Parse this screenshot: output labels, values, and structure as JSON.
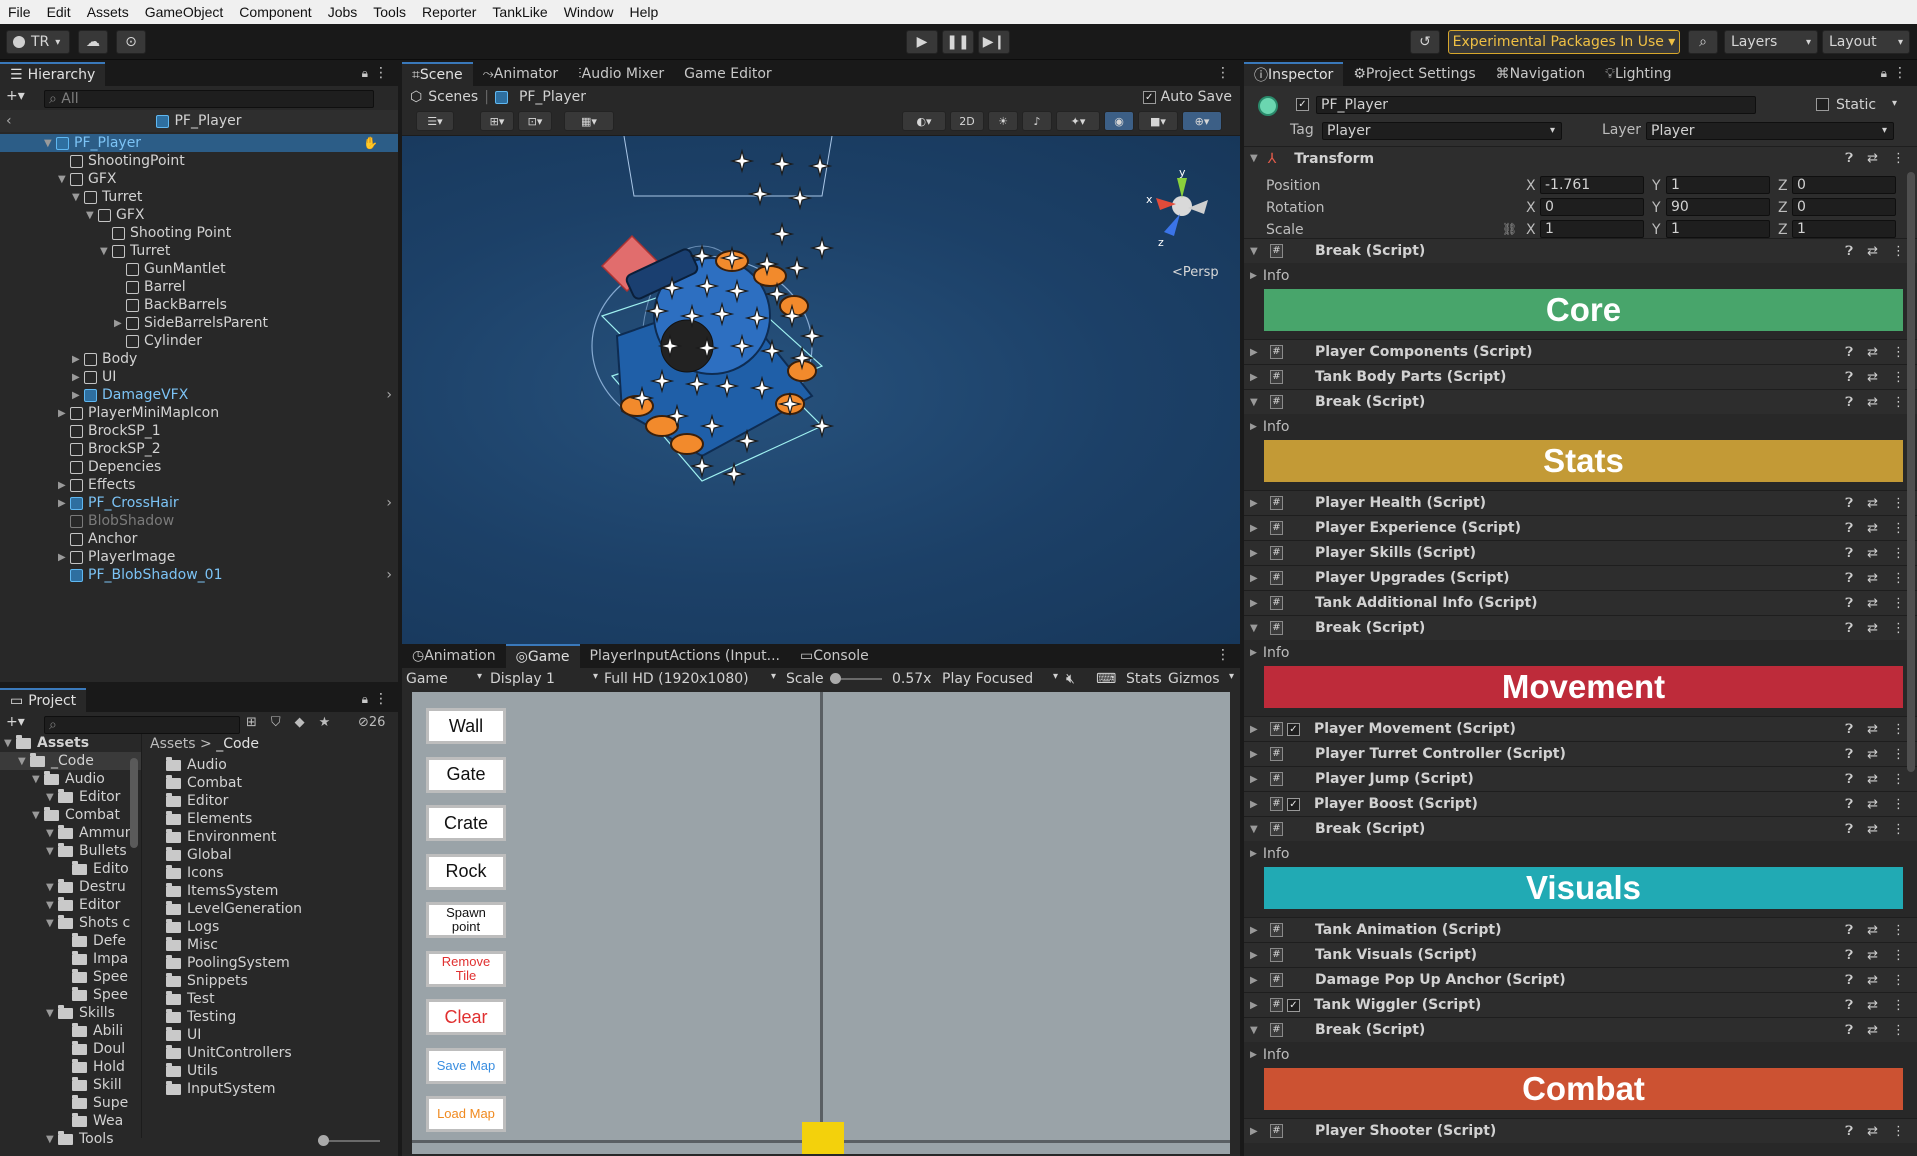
{
  "menu": [
    "File",
    "Edit",
    "Assets",
    "GameObject",
    "Component",
    "Jobs",
    "Tools",
    "Reporter",
    "TankLike",
    "Window",
    "Help"
  ],
  "toolbar": {
    "account": "TR",
    "experimental": "Experimental Packages In Use ▾",
    "layers": "Layers",
    "layout": "Layout"
  },
  "hierarchy": {
    "tab": "Hierarchy",
    "search_placeholder": "All",
    "scene": "PF_Player",
    "items": [
      {
        "label": "PF_Player",
        "depth": 0,
        "selected": true,
        "prefab": true,
        "exp": "▼"
      },
      {
        "label": "ShootingPoint",
        "depth": 1,
        "exp": ""
      },
      {
        "label": "GFX",
        "depth": 1,
        "exp": "▼"
      },
      {
        "label": "Turret",
        "depth": 2,
        "exp": "▼"
      },
      {
        "label": "GFX",
        "depth": 3,
        "exp": "▼"
      },
      {
        "label": "Shooting Point",
        "depth": 4,
        "exp": ""
      },
      {
        "label": "Turret",
        "depth": 4,
        "exp": "▼"
      },
      {
        "label": "GunMantlet",
        "depth": 5,
        "exp": ""
      },
      {
        "label": "Barrel",
        "depth": 5,
        "exp": ""
      },
      {
        "label": "BackBarrels",
        "depth": 5,
        "exp": ""
      },
      {
        "label": "SideBarrelsParent",
        "depth": 5,
        "exp": "▶"
      },
      {
        "label": "Cylinder",
        "depth": 5,
        "exp": ""
      },
      {
        "label": "Body",
        "depth": 2,
        "exp": "▶"
      },
      {
        "label": "UI",
        "depth": 2,
        "exp": "▶"
      },
      {
        "label": "DamageVFX",
        "depth": 2,
        "exp": "▶",
        "prefab": true
      },
      {
        "label": "PlayerMiniMapIcon",
        "depth": 1,
        "exp": "▶"
      },
      {
        "label": "BrockSP_1",
        "depth": 1,
        "exp": ""
      },
      {
        "label": "BrockSP_2",
        "depth": 1,
        "exp": ""
      },
      {
        "label": "Depencies",
        "depth": 1,
        "exp": ""
      },
      {
        "label": "Effects",
        "depth": 1,
        "exp": "▶"
      },
      {
        "label": "PF_CrossHair",
        "depth": 1,
        "exp": "▶",
        "prefab": true
      },
      {
        "label": "BlobShadow",
        "depth": 1,
        "exp": "",
        "dim": true
      },
      {
        "label": "Anchor",
        "depth": 1,
        "exp": ""
      },
      {
        "label": "PlayerImage",
        "depth": 1,
        "exp": "▶"
      },
      {
        "label": "PF_BlobShadow_01",
        "depth": 1,
        "exp": "",
        "prefab": true
      }
    ]
  },
  "project": {
    "tab": "Project",
    "count": "26",
    "tree": [
      {
        "label": "Assets",
        "depth": 0,
        "bold": true
      },
      {
        "label": "_Code",
        "depth": 1,
        "sel": true
      },
      {
        "label": "Audio",
        "depth": 2
      },
      {
        "label": "Editor",
        "depth": 3
      },
      {
        "label": "Combat",
        "depth": 2
      },
      {
        "label": "Ammun",
        "depth": 3
      },
      {
        "label": "Bullets",
        "depth": 3
      },
      {
        "label": "Edito",
        "depth": 4
      },
      {
        "label": "Destru",
        "depth": 3
      },
      {
        "label": "Editor",
        "depth": 3
      },
      {
        "label": "Shots c",
        "depth": 3
      },
      {
        "label": "Defe",
        "depth": 4
      },
      {
        "label": "Impa",
        "depth": 4
      },
      {
        "label": "Spee",
        "depth": 4
      },
      {
        "label": "Spee",
        "depth": 4
      },
      {
        "label": "Skills",
        "depth": 3
      },
      {
        "label": "Abili",
        "depth": 4
      },
      {
        "label": "Doul",
        "depth": 4
      },
      {
        "label": "Hold",
        "depth": 4
      },
      {
        "label": "Skill",
        "depth": 4
      },
      {
        "label": "Supe",
        "depth": 4
      },
      {
        "label": "Wea",
        "depth": 4
      },
      {
        "label": "Tools",
        "depth": 3
      }
    ],
    "breadcrumb": [
      "Assets",
      "_Code"
    ],
    "folders": [
      "Audio",
      "Combat",
      "Editor",
      "Elements",
      "Environment",
      "Global",
      "Icons",
      "ItemsSystem",
      "LevelGeneration",
      "Logs",
      "Misc",
      "PoolingSystem",
      "Snippets",
      "Test",
      "Testing",
      "UI",
      "UnitControllers",
      "Utils",
      "InputSystem"
    ]
  },
  "scene": {
    "tabs": [
      "Scene",
      "Animator",
      "Audio Mixer",
      "Game Editor"
    ],
    "breadcrumb": [
      "Scenes",
      "PF_Player"
    ],
    "auto_save": "Auto Save",
    "mode_2d": "2D",
    "persp": "Persp",
    "axis": {
      "x": "x",
      "y": "y",
      "z": "z"
    }
  },
  "game": {
    "tabs": [
      "Animation",
      "Game",
      "PlayerInputActions (Input...",
      "Console"
    ],
    "game_select": "Game",
    "display": "Display 1",
    "resolution": "Full HD (1920x1080)",
    "scale_label": "Scale",
    "scale_value": "0.57x",
    "play_focused": "Play Focused",
    "stats": "Stats",
    "gizmos": "Gizmos",
    "buttons": [
      {
        "label": "Wall",
        "color": "#111111"
      },
      {
        "label": "Gate",
        "color": "#111111"
      },
      {
        "label": "Crate",
        "color": "#111111"
      },
      {
        "label": "Rock",
        "color": "#111111"
      },
      {
        "label": "Spawn\npoint",
        "color": "#111111",
        "small": true
      },
      {
        "label": "Remove\nTile",
        "color": "#e03030",
        "small": true
      },
      {
        "label": "Clear",
        "color": "#e03030"
      },
      {
        "label": "Save Map",
        "color": "#3a8ee0",
        "small": true
      },
      {
        "label": "Load Map",
        "color": "#f08a20",
        "small": true
      }
    ]
  },
  "inspector": {
    "tabs": [
      "Inspector",
      "Project Settings",
      "Navigation",
      "Lighting"
    ],
    "name": "PF_Player",
    "static": "Static",
    "tag_label": "Tag",
    "tag": "Player",
    "layer_label": "Layer",
    "layer": "Player",
    "transform": {
      "title": "Transform",
      "position": {
        "label": "Position",
        "x": "-1.761",
        "y": "1",
        "z": "0"
      },
      "rotation": {
        "label": "Rotation",
        "x": "0",
        "y": "90",
        "z": "0"
      },
      "scale": {
        "label": "Scale",
        "x": "1",
        "y": "1",
        "z": "1"
      }
    },
    "blocks": [
      {
        "type": "script",
        "label": "Break (Script)",
        "exp": "▼"
      },
      {
        "type": "info",
        "label": "Info"
      },
      {
        "type": "header",
        "label": "Core",
        "color": "#48a56b"
      },
      {
        "type": "script",
        "label": "Player Components (Script)"
      },
      {
        "type": "script",
        "label": "Tank Body Parts (Script)"
      },
      {
        "type": "script",
        "label": "Break (Script)",
        "exp": "▼"
      },
      {
        "type": "info",
        "label": "Info"
      },
      {
        "type": "header",
        "label": "Stats",
        "color": "#c39a36"
      },
      {
        "type": "script",
        "label": "Player Health (Script)"
      },
      {
        "type": "script",
        "label": "Player Experience (Script)"
      },
      {
        "type": "script",
        "label": "Player Skills (Script)"
      },
      {
        "type": "script",
        "label": "Player Upgrades (Script)"
      },
      {
        "type": "script",
        "label": "Tank Additional Info (Script)"
      },
      {
        "type": "script",
        "label": "Break (Script)",
        "exp": "▼"
      },
      {
        "type": "info",
        "label": "Info"
      },
      {
        "type": "header",
        "label": "Movement",
        "color": "#be2b3a"
      },
      {
        "type": "script",
        "label": "Player Movement (Script)",
        "check": true
      },
      {
        "type": "script",
        "label": "Player Turret Controller (Script)"
      },
      {
        "type": "script",
        "label": "Player Jump (Script)"
      },
      {
        "type": "script",
        "label": "Player Boost (Script)",
        "check": true
      },
      {
        "type": "script",
        "label": "Break (Script)",
        "exp": "▼"
      },
      {
        "type": "info",
        "label": "Info"
      },
      {
        "type": "header",
        "label": "Visuals",
        "color": "#21aab4"
      },
      {
        "type": "script",
        "label": "Tank Animation (Script)"
      },
      {
        "type": "script",
        "label": "Tank Visuals (Script)"
      },
      {
        "type": "script",
        "label": "Damage Pop Up Anchor (Script)"
      },
      {
        "type": "script",
        "label": "Tank Wiggler (Script)",
        "check": true
      },
      {
        "type": "script",
        "label": "Break (Script)",
        "exp": "▼"
      },
      {
        "type": "info",
        "label": "Info"
      },
      {
        "type": "header",
        "label": "Combat",
        "color": "#cc5232"
      },
      {
        "type": "script",
        "label": "Player Shooter (Script)"
      }
    ]
  }
}
